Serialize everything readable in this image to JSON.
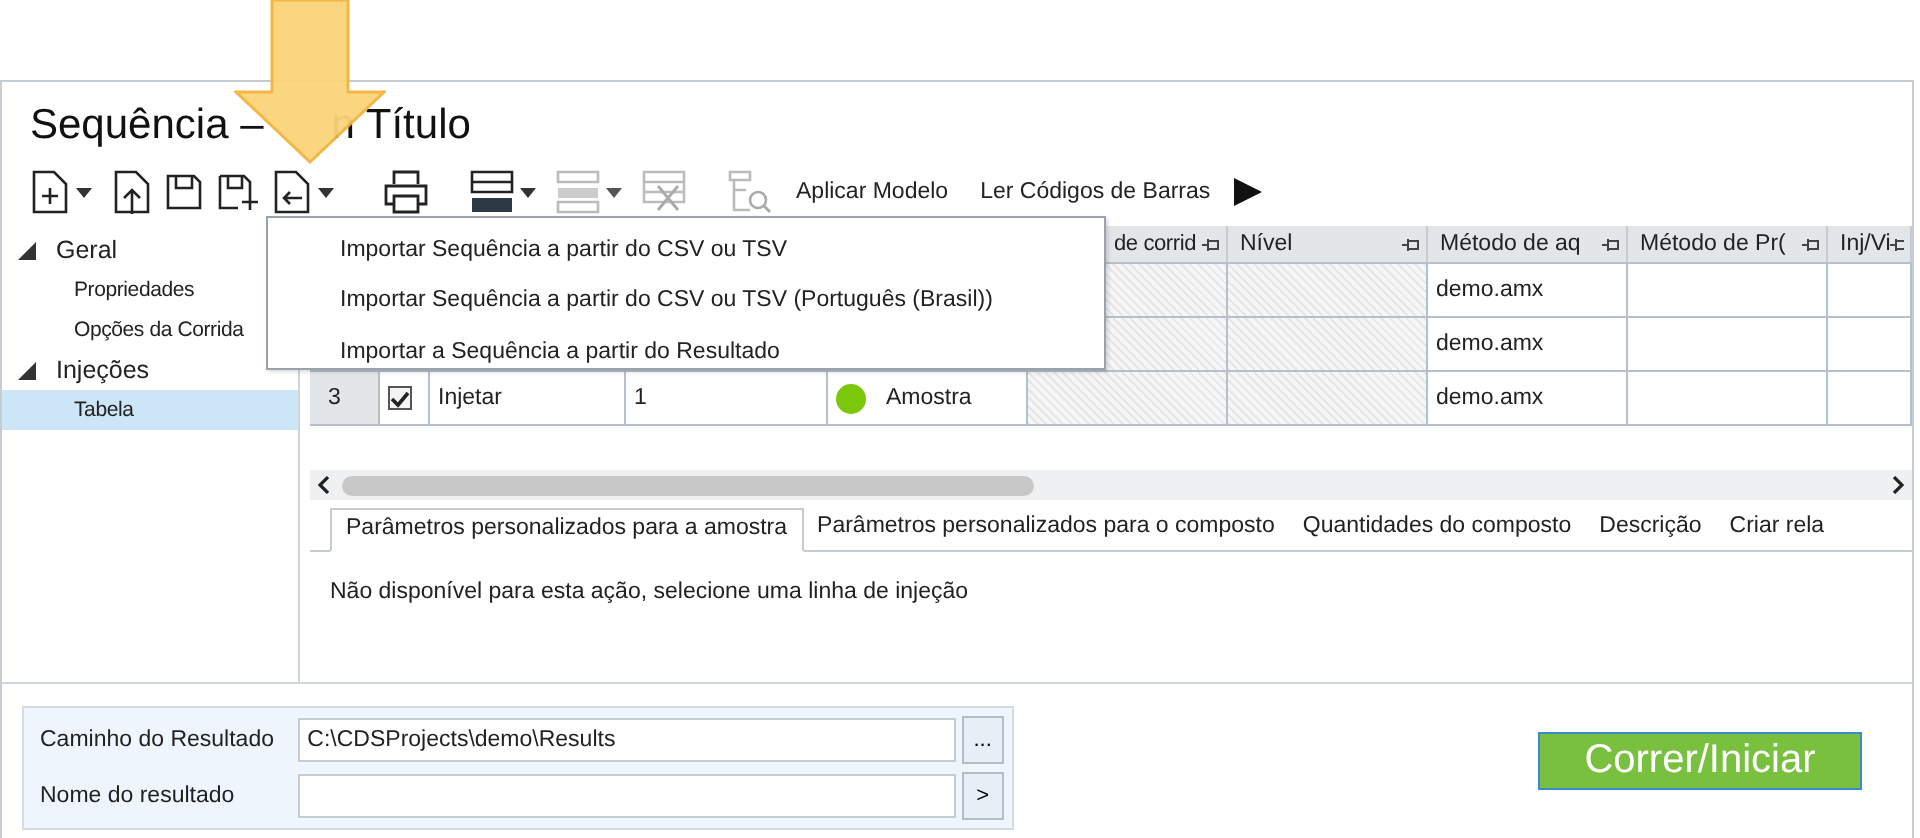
{
  "window": {
    "title_parts": [
      "Sequência –",
      "n Título"
    ]
  },
  "toolbar": {
    "buttons": [
      {
        "label": "Aplicar Modelo"
      },
      {
        "label": "Ler Códigos de Barras"
      }
    ]
  },
  "import_menu": {
    "items": [
      {
        "label": "Importar Sequência a partir do CSV ou TSV"
      },
      {
        "label": "Importar Sequência a partir do CSV ou TSV (Português (Brasil))"
      },
      {
        "label": "Importar a Sequência a partir do Resultado"
      }
    ]
  },
  "sidebar": {
    "items": [
      {
        "label": "Geral",
        "expanded": true,
        "selected": false,
        "children": [
          {
            "label": "Propriedades",
            "selected": false
          },
          {
            "label": "Opções da Corrida",
            "selected": false
          }
        ]
      },
      {
        "label": "Injeções",
        "expanded": true,
        "selected": false,
        "children": [
          {
            "label": "Tabela",
            "selected": true
          }
        ]
      }
    ]
  },
  "table": {
    "columns": [
      {
        "label": "de corrid"
      },
      {
        "label": "Nível"
      },
      {
        "label": "Método de aq"
      },
      {
        "label": "Método de Pr("
      },
      {
        "label": "Inj/Vi"
      }
    ],
    "rows": [
      {
        "method": "demo.amx"
      },
      {
        "method": "demo.amx"
      },
      {
        "number": "3",
        "checked": true,
        "type": "Injetar",
        "value": "1",
        "color": "#7ac70c",
        "sample_type": "Amostra",
        "method": "demo.amx"
      }
    ]
  },
  "detail_tabs": [
    {
      "label": "Parâmetros personalizados para a amostra",
      "selected": true
    },
    {
      "label": "Parâmetros personalizados para o composto",
      "selected": false
    },
    {
      "label": "Quantidades do composto",
      "selected": false
    },
    {
      "label": "Descrição",
      "selected": false
    },
    {
      "label": "Criar rela",
      "selected": false
    }
  ],
  "detail_message": "Não disponível para esta ação, selecione uma linha de injeção",
  "result_form": {
    "fields": [
      {
        "label": "Caminho do Resultado",
        "value": "C:\\CDSProjects\\demo\\Results",
        "button": "..."
      },
      {
        "label": "Nome do resultado",
        "button": ">"
      }
    ]
  },
  "run_button": {
    "label": "Correr/Iniciar"
  }
}
